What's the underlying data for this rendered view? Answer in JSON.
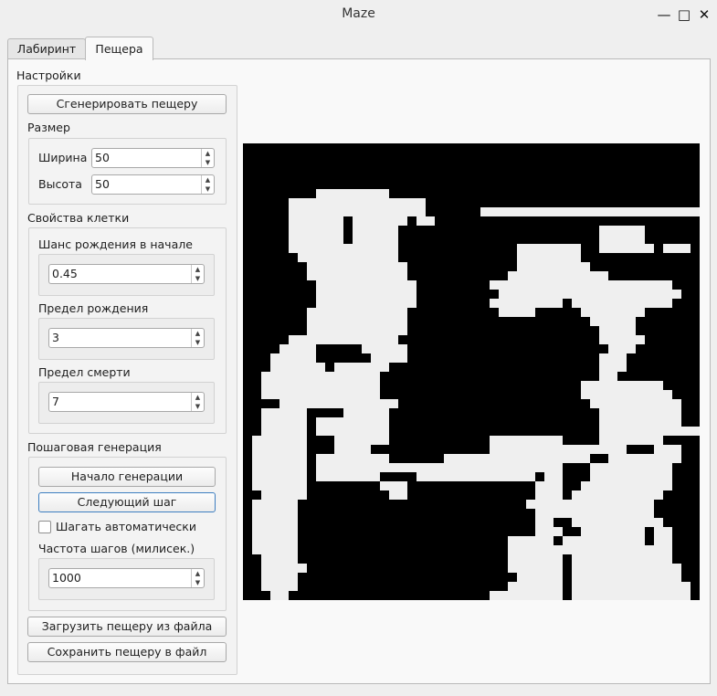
{
  "window": {
    "title": "Maze",
    "minimize_glyph": "—",
    "maximize_glyph": "□",
    "close_glyph": "✕"
  },
  "tabs": [
    {
      "label": "Лабиринт"
    },
    {
      "label": "Пещера"
    }
  ],
  "settings": {
    "title": "Настройки",
    "generate_button": "Сгенерировать пещеру",
    "size": {
      "title": "Размер",
      "width_label": "Ширина",
      "width_value": "50",
      "height_label": "Высота",
      "height_value": "50"
    },
    "cell_properties": {
      "title": "Свойства клетки",
      "birth_chance_label": "Шанс рождения в начале",
      "birth_chance_value": "0.45",
      "birth_limit_label": "Предел рождения",
      "birth_limit_value": "3",
      "death_limit_label": "Предел смерти",
      "death_limit_value": "7"
    },
    "stepwise": {
      "title": "Пошаговая генерация",
      "start_button": "Начало генерации",
      "next_step_button": "Следующий шаг",
      "auto_step_label": "Шагать автоматически",
      "auto_step_checked": false,
      "step_frequency_label": "Частота шагов (милисек.)",
      "step_frequency_value": "1000"
    },
    "load_button": "Загрузить пещеру из файла",
    "save_button": "Сохранить пещеру в файл"
  },
  "cave": {
    "cols": 50,
    "rows": 50,
    "wall_color": "#000000",
    "open_color": "#efefef",
    "open_runs": [
      [],
      [],
      [],
      [],
      [],
      [
        [
          8,
          15
        ]
      ],
      [
        [
          5,
          19
        ]
      ],
      [
        [
          5,
          19
        ],
        [
          26,
          57
        ]
      ],
      [
        [
          5,
          10
        ],
        [
          12,
          17
        ],
        [
          19,
          20
        ],
        [
          26,
          25
        ]
      ],
      [
        [
          5,
          10
        ],
        [
          12,
          16
        ],
        [
          39,
          43
        ]
      ],
      [
        [
          5,
          10
        ],
        [
          12,
          16
        ],
        [
          39,
          43
        ]
      ],
      [
        [
          5,
          16
        ],
        [
          30,
          36
        ],
        [
          39,
          44
        ],
        [
          46,
          48
        ]
      ],
      [
        [
          6,
          16
        ],
        [
          30,
          36
        ]
      ],
      [
        [
          7,
          17
        ],
        [
          30,
          37
        ]
      ],
      [
        [
          7,
          17
        ],
        [
          29,
          39
        ]
      ],
      [
        [
          8,
          18
        ],
        [
          27,
          46
        ]
      ],
      [
        [
          8,
          18
        ],
        [
          28,
          47
        ]
      ],
      [
        [
          8,
          18
        ],
        [
          27,
          34
        ],
        [
          36,
          46
        ]
      ],
      [
        [
          7,
          17
        ],
        [
          28,
          31
        ],
        [
          37,
          43
        ]
      ],
      [
        [
          7,
          17
        ],
        [
          38,
          42
        ]
      ],
      [
        [
          7,
          17
        ],
        [
          39,
          42
        ]
      ],
      [
        [
          5,
          16
        ],
        [
          39,
          43
        ]
      ],
      [
        [
          4,
          7
        ],
        [
          13,
          17
        ],
        [
          40,
          42
        ]
      ],
      [
        [
          3,
          7
        ],
        [
          14,
          17
        ],
        [
          39,
          41
        ]
      ],
      [
        [
          3,
          8
        ],
        [
          10,
          15
        ],
        [
          39,
          41
        ]
      ],
      [
        [
          2,
          14
        ],
        [
          39,
          40
        ]
      ],
      [
        [
          2,
          14
        ],
        [
          37,
          45
        ]
      ],
      [
        [
          2,
          14
        ],
        [
          37,
          46
        ]
      ],
      [
        [
          4,
          16
        ],
        [
          38,
          47
        ]
      ],
      [
        [
          2,
          6
        ],
        [
          11,
          15
        ],
        [
          39,
          47
        ]
      ],
      [
        [
          2,
          6
        ],
        [
          8,
          15
        ],
        [
          39,
          47
        ]
      ],
      [
        [
          2,
          6
        ],
        [
          8,
          15
        ],
        [
          39,
          49
        ]
      ],
      [
        [
          1,
          6
        ],
        [
          10,
          15
        ],
        [
          27,
          34
        ],
        [
          39,
          45
        ]
      ],
      [
        [
          1,
          6
        ],
        [
          10,
          13
        ],
        [
          27,
          35
        ],
        [
          36,
          41
        ],
        [
          45,
          47
        ]
      ],
      [
        [
          1,
          6
        ],
        [
          8,
          15
        ],
        [
          22,
          30
        ],
        [
          31,
          37
        ],
        [
          40,
          47
        ]
      ],
      [
        [
          1,
          6
        ],
        [
          8,
          17
        ],
        [
          18,
          21
        ],
        [
          22,
          30
        ],
        [
          31,
          34
        ],
        [
          38,
          46
        ]
      ],
      [
        [
          1,
          6
        ],
        [
          8,
          14
        ],
        [
          19,
          21
        ],
        [
          22,
          31
        ],
        [
          33,
          34
        ],
        [
          38,
          46
        ]
      ],
      [
        [
          1,
          6
        ],
        [
          15,
          17
        ],
        [
          32,
          34
        ],
        [
          37,
          46
        ]
      ],
      [
        [
          2,
          6
        ],
        [
          16,
          17
        ],
        [
          32,
          34
        ],
        [
          36,
          45
        ]
      ],
      [
        [
          1,
          5
        ],
        [
          31,
          34
        ],
        [
          35,
          44
        ]
      ],
      [
        [
          1,
          5
        ],
        [
          32,
          34
        ],
        [
          35,
          44
        ]
      ],
      [
        [
          1,
          5
        ],
        [
          32,
          33
        ],
        [
          36,
          43
        ],
        [
          44,
          45
        ]
      ],
      [
        [
          1,
          5
        ],
        [
          32,
          34
        ],
        [
          37,
          43
        ],
        [
          45,
          46
        ]
      ],
      [
        [
          1,
          5
        ],
        [
          29,
          33
        ],
        [
          35,
          43
        ],
        [
          45,
          46
        ]
      ],
      [
        [
          1,
          5
        ],
        [
          29,
          34
        ],
        [
          35,
          44
        ],
        [
          45,
          46
        ]
      ],
      [
        [
          2,
          5
        ],
        [
          29,
          34
        ],
        [
          36,
          44
        ],
        [
          45,
          46
        ]
      ],
      [
        [
          2,
          6
        ],
        [
          29,
          34
        ],
        [
          36,
          45
        ],
        [
          46,
          47
        ]
      ],
      [
        [
          2,
          5
        ],
        [
          30,
          34
        ],
        [
          36,
          45
        ],
        [
          46,
          47
        ]
      ],
      [
        [
          2,
          5
        ],
        [
          29,
          34
        ],
        [
          36,
          45
        ],
        [
          46,
          48
        ]
      ],
      [
        [
          3,
          4
        ],
        [
          27,
          34
        ],
        [
          36,
          46
        ],
        [
          47,
          48
        ]
      ]
    ]
  }
}
